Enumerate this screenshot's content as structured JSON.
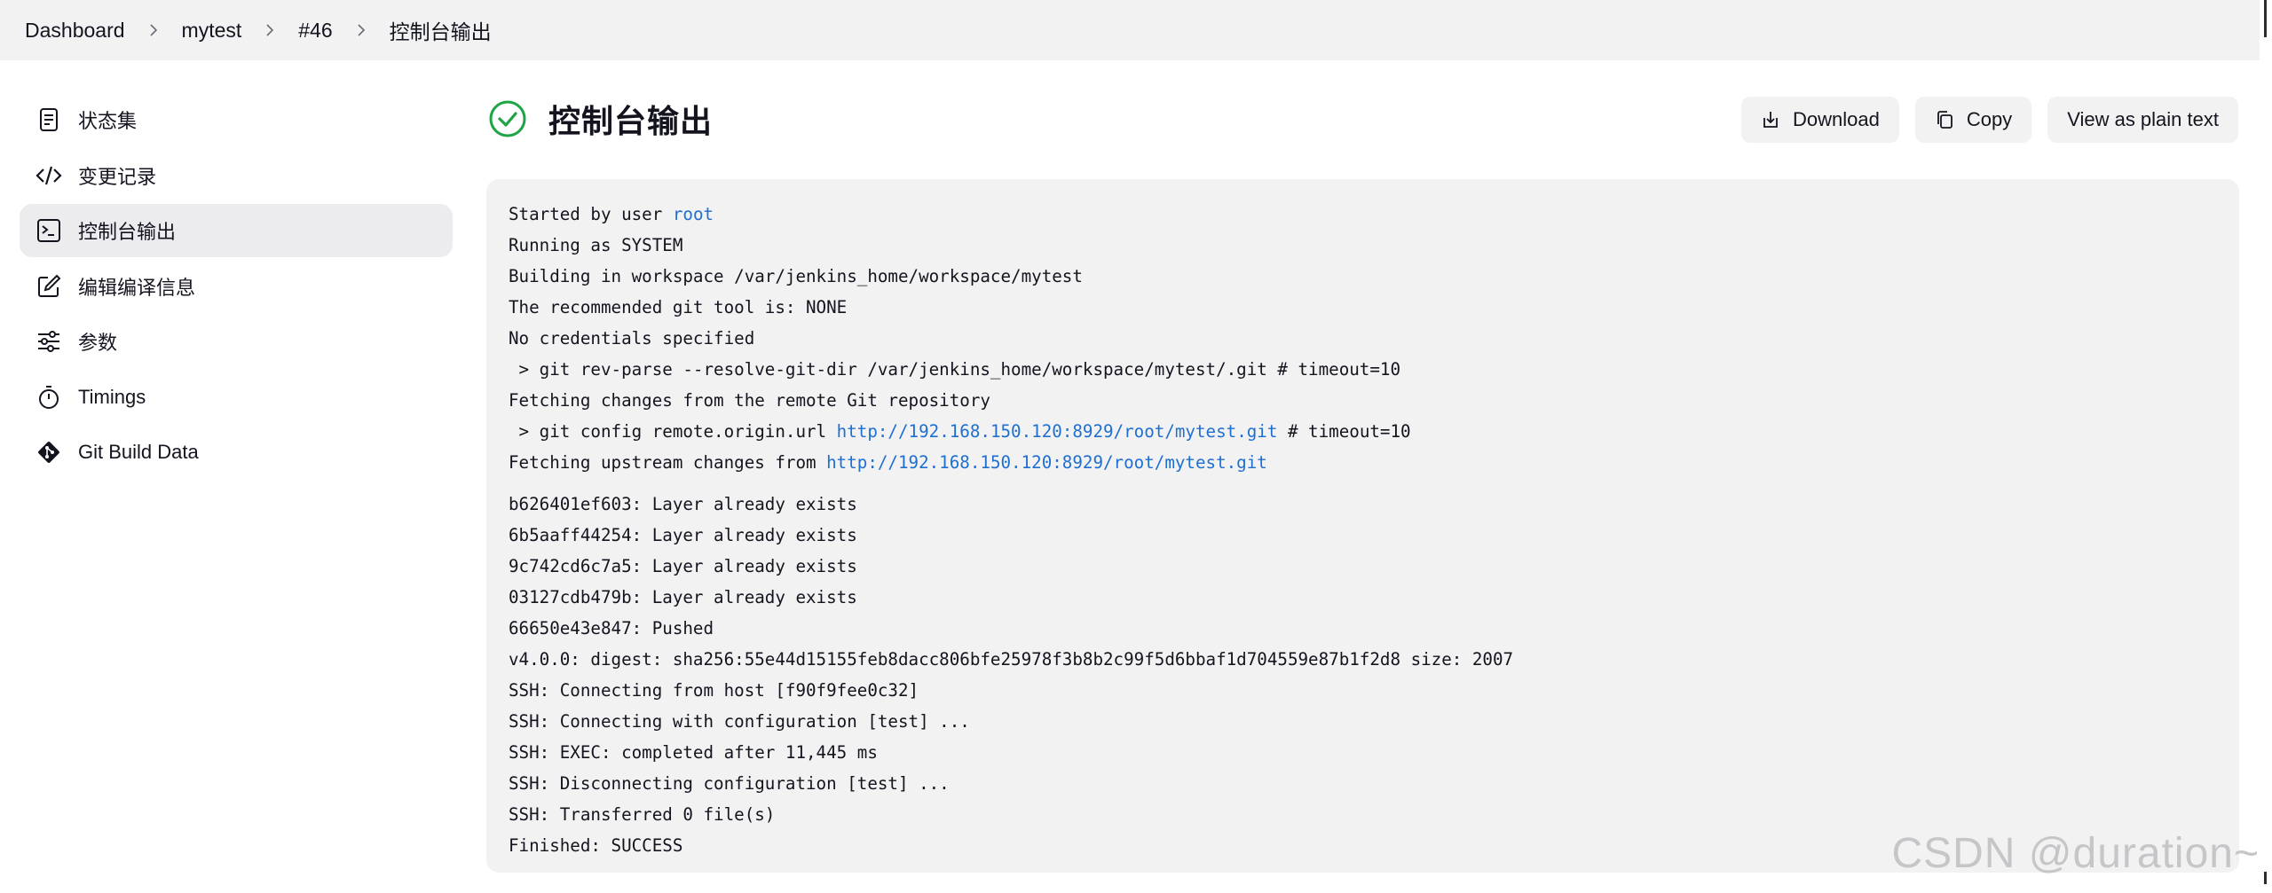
{
  "breadcrumb": [
    "Dashboard",
    "mytest",
    "#46",
    "控制台输出"
  ],
  "sidebar": {
    "items": [
      {
        "label": "状态集",
        "icon": "document-icon"
      },
      {
        "label": "变更记录",
        "icon": "code-icon"
      },
      {
        "label": "控制台输出",
        "icon": "terminal-icon",
        "active": true
      },
      {
        "label": "编辑编译信息",
        "icon": "edit-icon"
      },
      {
        "label": "参数",
        "icon": "sliders-icon"
      },
      {
        "label": "Timings",
        "icon": "stopwatch-icon"
      },
      {
        "label": "Git Build Data",
        "icon": "git-icon"
      }
    ]
  },
  "page": {
    "title": "控制台输出",
    "status_icon": "success-check-icon",
    "status_color": "#1ea446"
  },
  "actions": {
    "download": "Download",
    "copy": "Copy",
    "plain": "View as plain text"
  },
  "console": {
    "started_prefix": "Started by user ",
    "started_user": "root",
    "lines_a": [
      "Running as SYSTEM",
      "Building in workspace /var/jenkins_home/workspace/mytest",
      "The recommended git tool is: NONE",
      "No credentials specified",
      " > git rev-parse --resolve-git-dir /var/jenkins_home/workspace/mytest/.git # timeout=10",
      "Fetching changes from the remote Git repository"
    ],
    "config_prefix": " > git config remote.origin.url ",
    "config_url": "http://192.168.150.120:8929/root/mytest.git",
    "config_suffix": " # timeout=10",
    "fetch_prefix": "Fetching upstream changes from ",
    "fetch_url": "http://192.168.150.120:8929/root/mytest.git",
    "lines_b": [
      "b626401ef603: Layer already exists",
      "6b5aaff44254: Layer already exists",
      "9c742cd6c7a5: Layer already exists",
      "03127cdb479b: Layer already exists",
      "66650e43e847: Pushed",
      "v4.0.0: digest: sha256:55e44d15155feb8dacc806bfe25978f3b8b2c99f5d6bbaf1d704559e87b1f2d8 size: 2007",
      "SSH: Connecting from host [f90f9fee0c32]",
      "SSH: Connecting with configuration [test] ...",
      "SSH: EXEC: completed after 11,445 ms",
      "SSH: Disconnecting configuration [test] ...",
      "SSH: Transferred 0 file(s)",
      "Finished: SUCCESS"
    ]
  },
  "watermark": "CSDN @duration~"
}
